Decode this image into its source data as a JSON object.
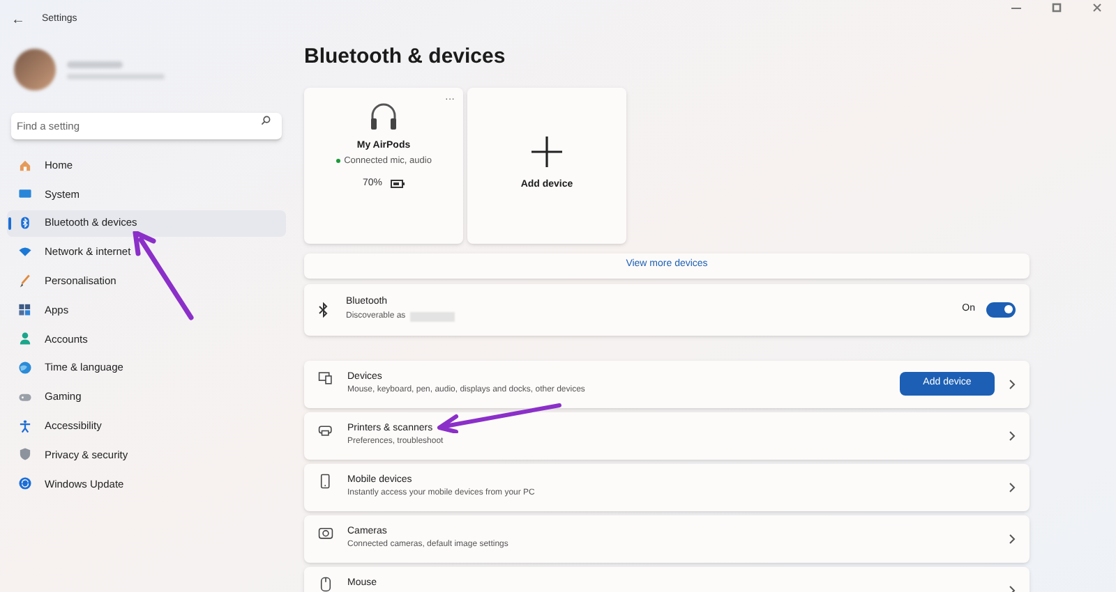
{
  "window": {
    "title": "Settings",
    "back_icon": "←"
  },
  "search": {
    "placeholder": "Find a setting"
  },
  "sidebar": {
    "items": [
      {
        "label": "Home",
        "selected": false
      },
      {
        "label": "System",
        "selected": false
      },
      {
        "label": "Bluetooth & devices",
        "selected": true
      },
      {
        "label": "Network & internet",
        "selected": false
      },
      {
        "label": "Personalisation",
        "selected": false
      },
      {
        "label": "Apps",
        "selected": false
      },
      {
        "label": "Accounts",
        "selected": false
      },
      {
        "label": "Time & language",
        "selected": false
      },
      {
        "label": "Gaming",
        "selected": false
      },
      {
        "label": "Accessibility",
        "selected": false
      },
      {
        "label": "Privacy & security",
        "selected": false
      },
      {
        "label": "Windows Update",
        "selected": false
      }
    ]
  },
  "page_title": "Bluetooth & devices",
  "device_cards": [
    {
      "kind": "device",
      "name": "My AirPods",
      "status": "Connected mic, audio",
      "battery": "70%",
      "more": "···"
    },
    {
      "kind": "add",
      "label": "Add device"
    }
  ],
  "view_more": "View more devices",
  "bluetooth": {
    "title": "Bluetooth",
    "subtitle": "Discoverable as",
    "state_label": "On",
    "on": true
  },
  "rows": [
    {
      "kind": "button",
      "title": "Devices",
      "subtitle": "Mouse, keyboard, pen, audio, displays and docks, other devices",
      "button": "Add device"
    },
    {
      "kind": "plain",
      "title": "Printers & scanners",
      "subtitle": "Preferences, troubleshoot"
    },
    {
      "kind": "plain",
      "title": "Mobile devices",
      "subtitle": "Instantly access your mobile devices from your PC"
    },
    {
      "kind": "plain",
      "title": "Cameras",
      "subtitle": "Connected cameras, default image settings"
    },
    {
      "kind": "plain",
      "title": "Mouse"
    }
  ]
}
